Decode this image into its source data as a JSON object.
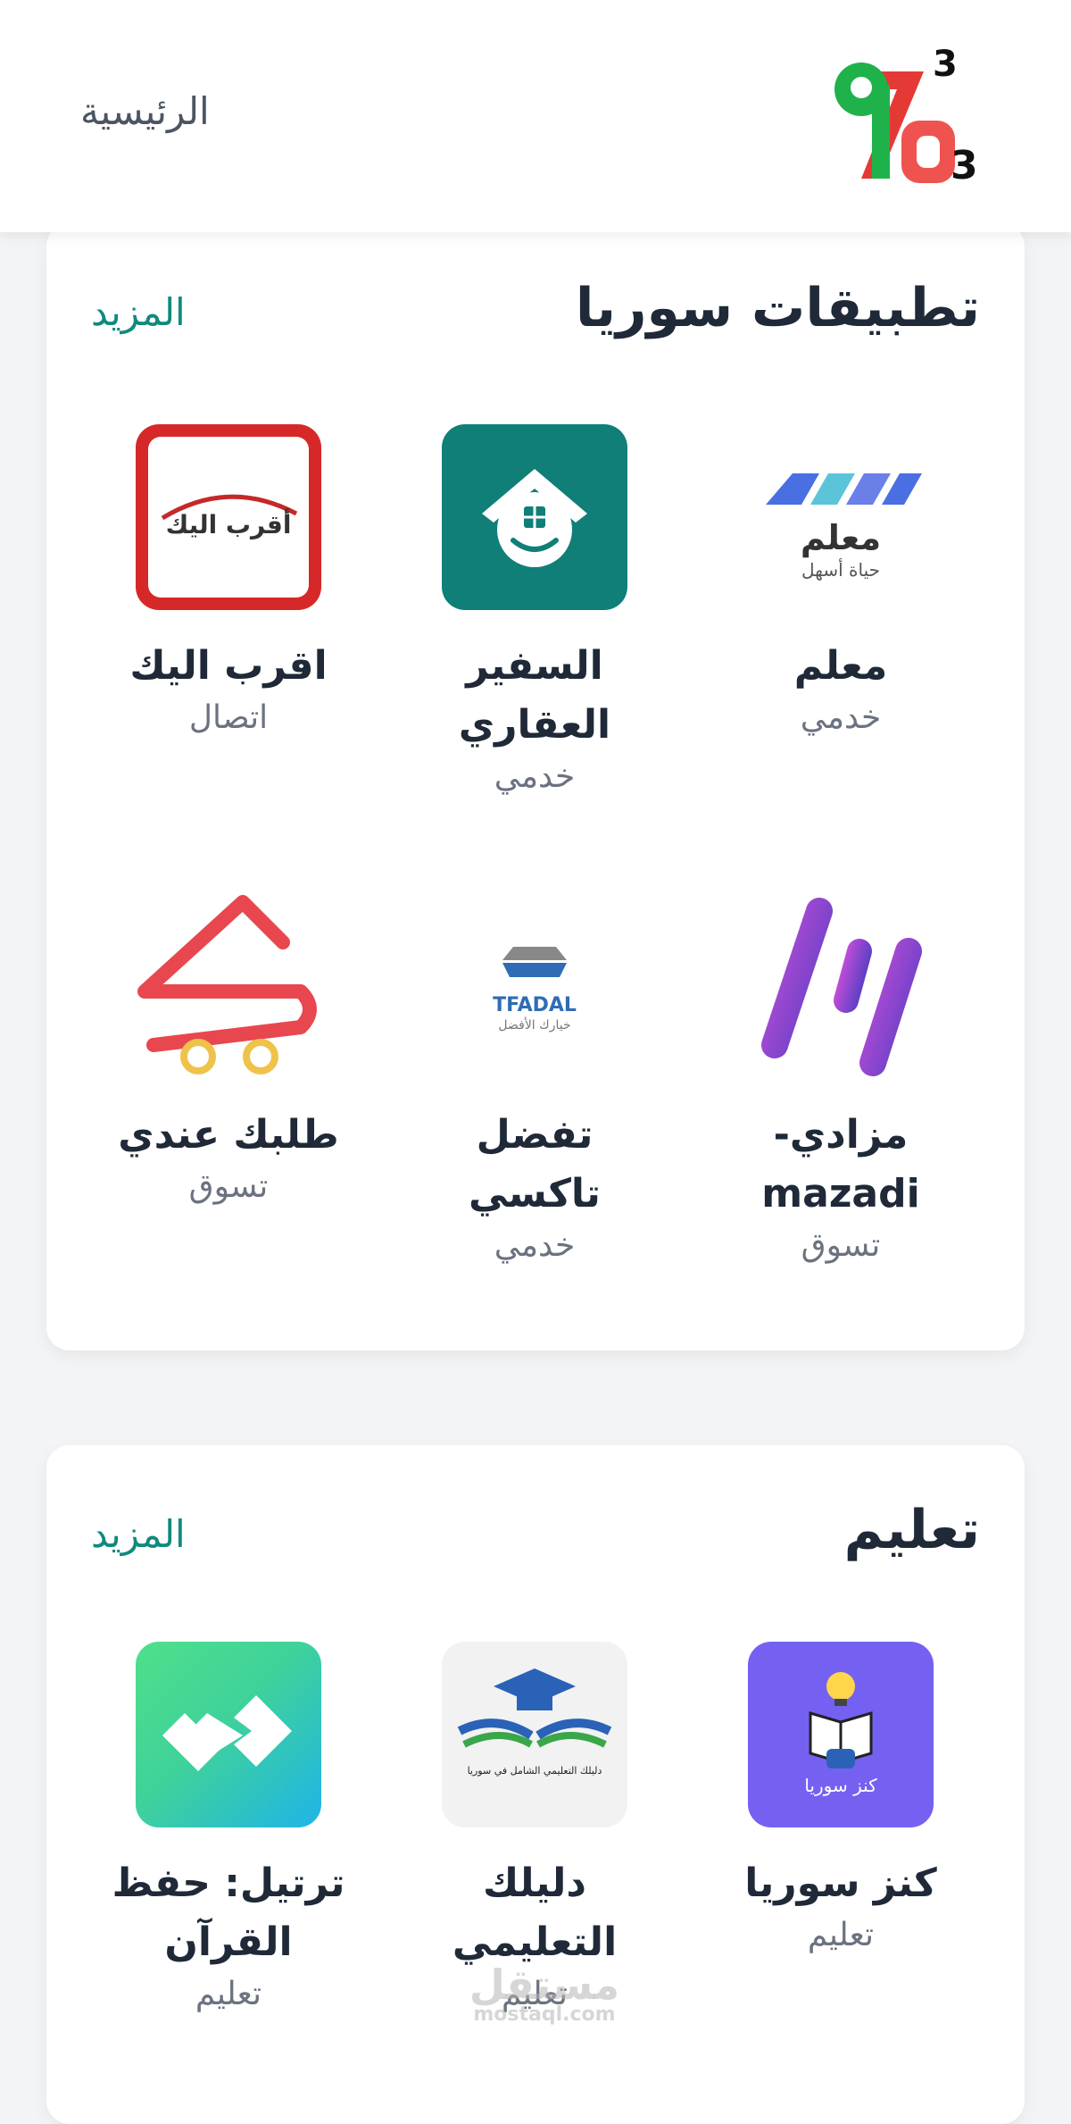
{
  "header": {
    "home_label": "الرئيسية",
    "logo_text": "963"
  },
  "sections": [
    {
      "title": "تطبيقات سوريا",
      "more": "المزيد",
      "apps": [
        {
          "name": "معلم",
          "category": "خدمي",
          "icon": "moalem-logo-icon"
        },
        {
          "name": "السفير العقاري",
          "category": "خدمي",
          "icon": "house-smile-icon"
        },
        {
          "name": "اقرب اليك",
          "category": "اتصال",
          "icon": "aqrab-alaik-logo-icon"
        },
        {
          "name": "مزادي- mazadi",
          "category": "تسوق",
          "icon": "mazadi-logo-icon"
        },
        {
          "name": "تفضل تاكسي",
          "category": "خدمي",
          "icon": "tfadal-taxi-logo-icon"
        },
        {
          "name": "طلبك عندي",
          "category": "تسوق",
          "icon": "delivery-cart-icon"
        }
      ],
      "icon_text": {
        "moalem": "معلم",
        "moalem_tag": "حياة أسهل",
        "aqrab": "أقرب اليك",
        "tfadal": "TFADAL",
        "tfadal_tag": "خيارك الأفضل"
      }
    },
    {
      "title": "تعليم",
      "more": "المزيد",
      "apps": [
        {
          "name": "كنز سوريا",
          "category": "تعليم",
          "icon": "book-bulb-icon"
        },
        {
          "name": "دليلك التعليمي",
          "category": "تعليم",
          "icon": "graduation-book-icon"
        },
        {
          "name": "ترتيل: حفظ القرآن",
          "category": "تعليم",
          "icon": "tarteel-logo-icon"
        }
      ],
      "icon_text": {
        "kanz": "كنز سوريا",
        "daleel": "دليلك التعليمي الشامل في سوريا"
      }
    }
  ],
  "watermark": {
    "main": "مستقل",
    "sub": "mostaql.com"
  },
  "colors": {
    "accent": "#0f8a7e",
    "header_bg": "#ffffff",
    "page_bg": "#f3f4f6"
  }
}
